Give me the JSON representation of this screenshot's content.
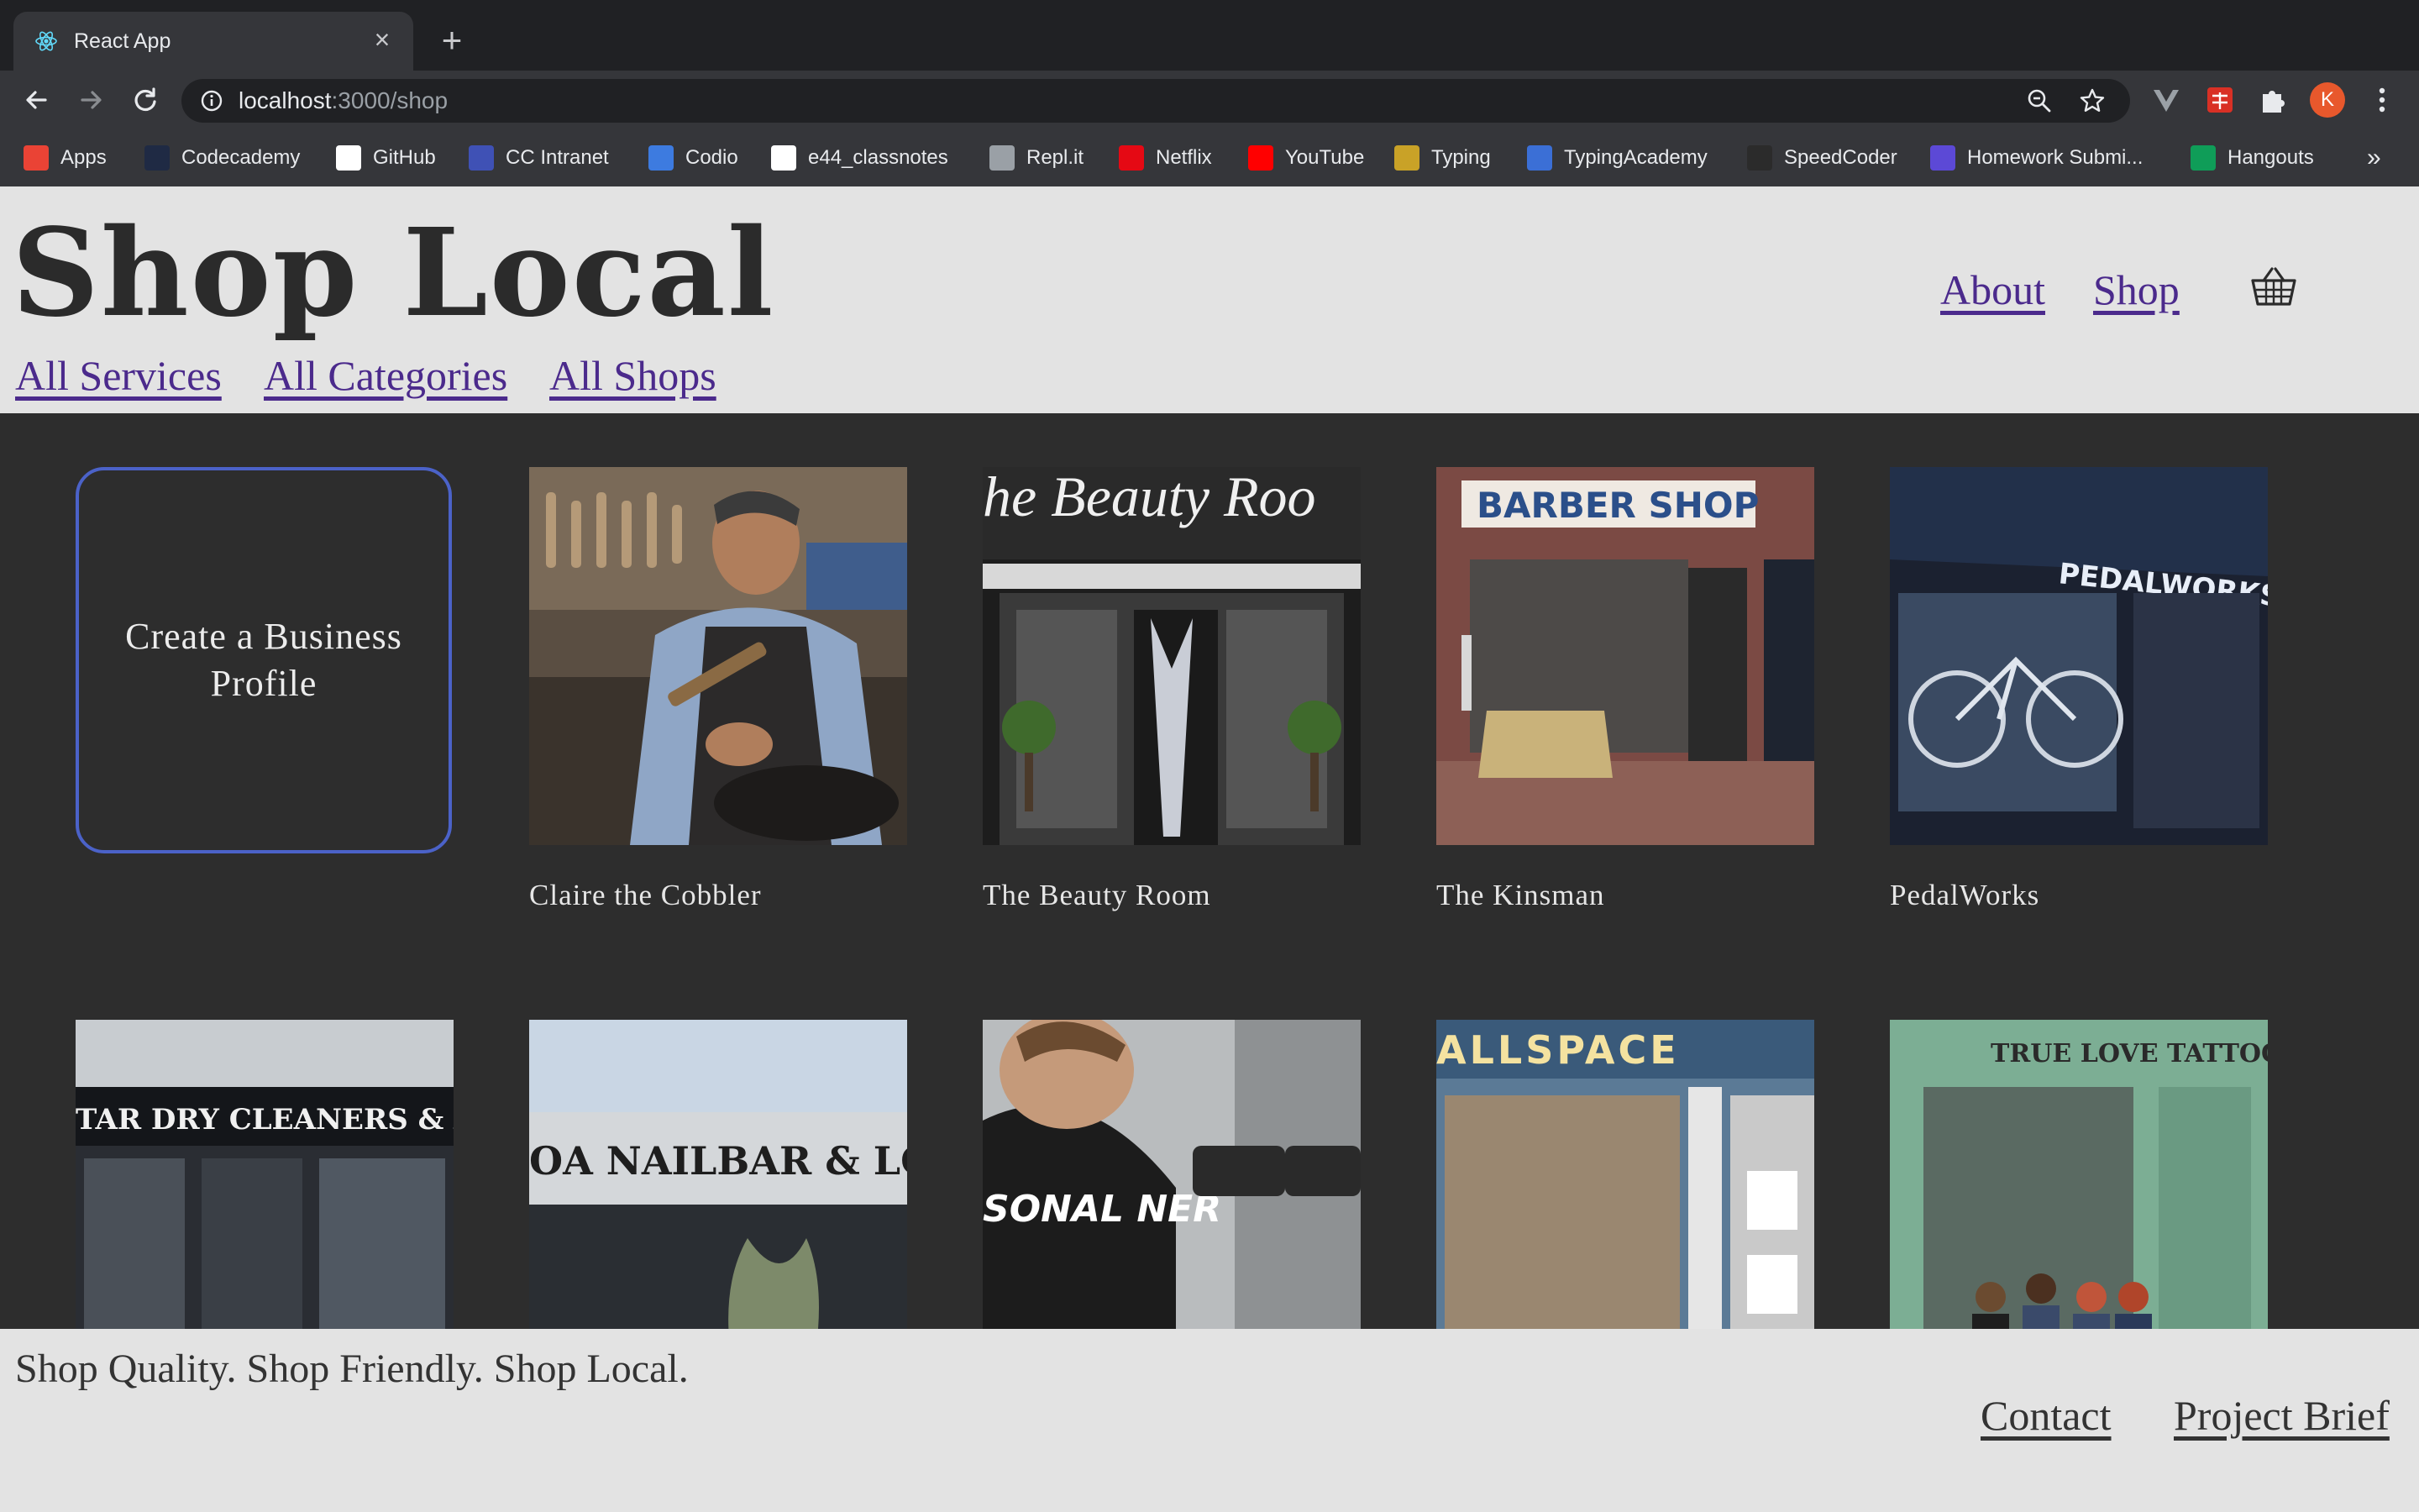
{
  "browser": {
    "tab_title": "React App",
    "url_host": "localhost",
    "url_rest": ":3000/shop",
    "profile_initial": "K",
    "bookmarks": [
      {
        "label": "Apps",
        "icon": "apps-grid-icon",
        "color": "#ea4335"
      },
      {
        "label": "Codecademy",
        "icon": "codecademy-icon",
        "color": "#1f2a44"
      },
      {
        "label": "GitHub",
        "icon": "github-icon",
        "color": "#ffffff"
      },
      {
        "label": "CC Intranet",
        "icon": "cc-intranet-icon",
        "color": "#3f51b5"
      },
      {
        "label": "Codio",
        "icon": "codio-icon",
        "color": "#3d7be0"
      },
      {
        "label": "e44_classnotes",
        "icon": "github-icon",
        "color": "#ffffff"
      },
      {
        "label": "Repl.it",
        "icon": "replit-icon",
        "color": "#9aa0a6"
      },
      {
        "label": "Netflix",
        "icon": "netflix-icon",
        "color": "#e50914"
      },
      {
        "label": "YouTube",
        "icon": "youtube-icon",
        "color": "#ff0000"
      },
      {
        "label": "Typing",
        "icon": "typing-icon",
        "color": "#c9a227"
      },
      {
        "label": "TypingAcademy",
        "icon": "typingacademy-icon",
        "color": "#3b6fd6"
      },
      {
        "label": "SpeedCoder",
        "icon": "speedcoder-icon",
        "color": "#2b2b2b"
      },
      {
        "label": "Homework Submi...",
        "icon": "homework-icon",
        "color": "#5c49d6"
      },
      {
        "label": "Hangouts",
        "icon": "hangouts-icon",
        "color": "#0f9d58"
      }
    ]
  },
  "header": {
    "title": "Shop Local",
    "nav": {
      "about": "About",
      "shop": "Shop"
    },
    "subnav": {
      "services": "All Services",
      "categories": "All Categories",
      "shops": "All Shops"
    }
  },
  "main": {
    "create_label": "Create a Business Profile",
    "shops": [
      {
        "name": "Claire the Cobbler",
        "sign": ""
      },
      {
        "name": "The Beauty Room",
        "sign": "he Beauty Roo"
      },
      {
        "name": "The Kinsman",
        "sign": "BARBER SHOP"
      },
      {
        "name": "PedalWorks",
        "sign": "PEDALWORKS"
      },
      {
        "name": "",
        "sign": "TAR DRY CLEANERS & ALTERATI"
      },
      {
        "name": "",
        "sign": "OA NAILBAR & LOUNG"
      },
      {
        "name": "",
        "sign": "SONAL NER"
      },
      {
        "name": "",
        "sign": "ALLSPACE"
      },
      {
        "name": "",
        "sign": "TRUE LOVE TATTOO"
      }
    ]
  },
  "footer": {
    "tagline": "Shop Quality. Shop Friendly. Shop Local.",
    "contact": "Contact",
    "brief": "Project Brief"
  }
}
